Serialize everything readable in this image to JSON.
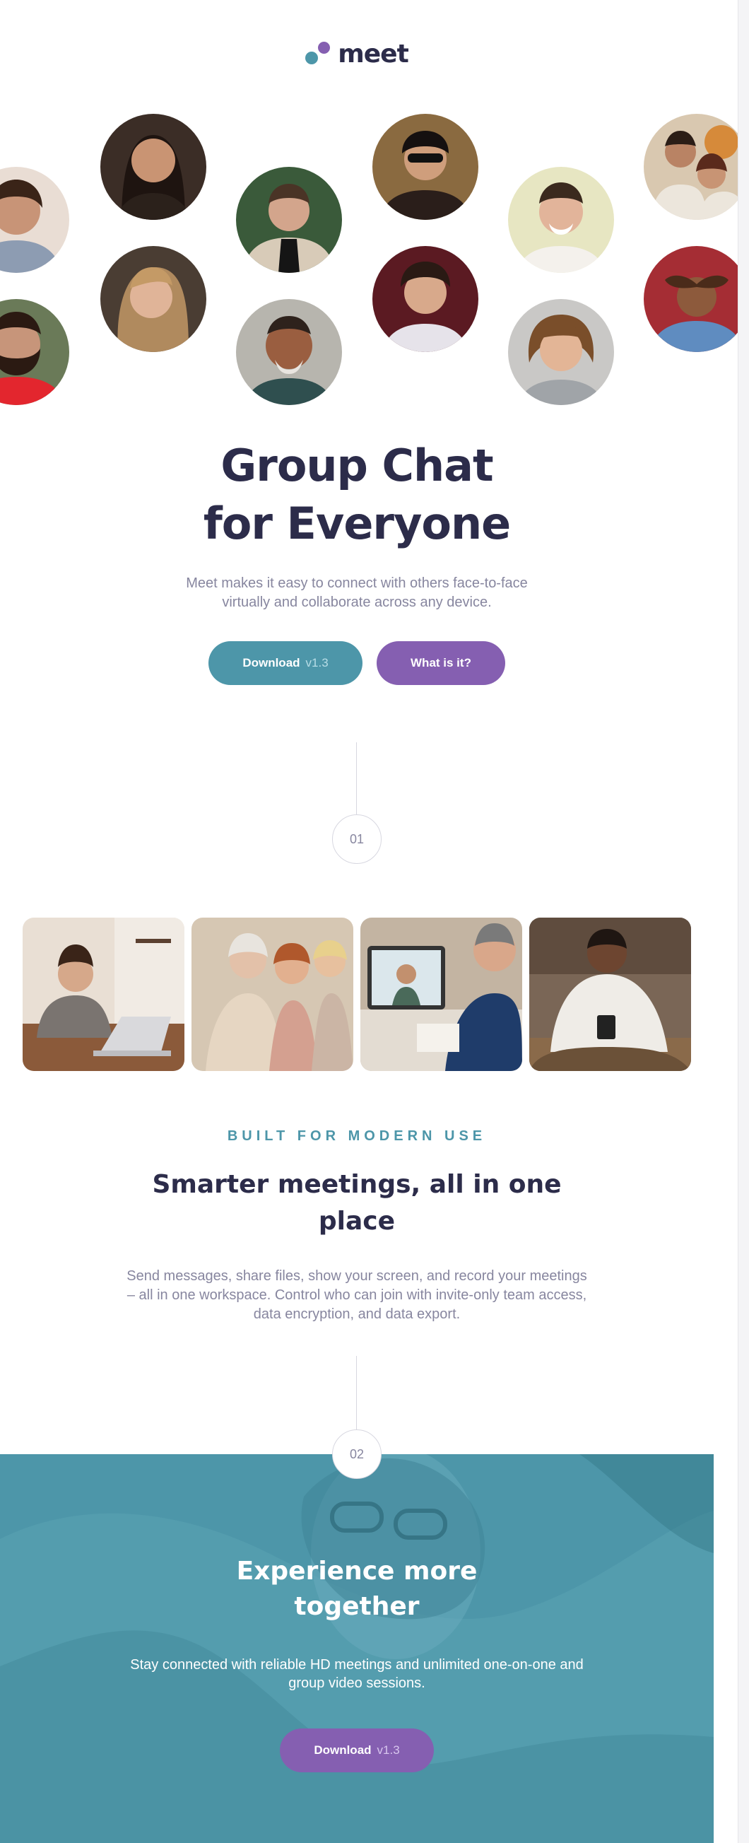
{
  "brand": {
    "name": "meet",
    "accent": "#4d96a9",
    "secondary": "#855fb1",
    "dark": "#2c2c4a"
  },
  "avatars": [
    "person-portrait-1",
    "person-portrait-2",
    "person-portrait-3",
    "person-portrait-4",
    "person-portrait-5",
    "person-portrait-6",
    "person-portrait-7",
    "person-portrait-8",
    "person-portrait-9",
    "person-portrait-10",
    "person-portrait-11",
    "person-portrait-12"
  ],
  "hero": {
    "title_line1": "Group Chat",
    "title_line2": "for Everyone",
    "subtitle": "Meet makes it easy to connect with others face-to-face virtually and collaborate across any device.",
    "download_label": "Download",
    "download_version": "v1.3",
    "what_label": "What is it?"
  },
  "step1": {
    "number": "01"
  },
  "photos": [
    "woman-laptop-photo",
    "women-phone-photo",
    "man-video-call-photo",
    "man-phone-photo"
  ],
  "section1": {
    "eyebrow": "BUILT FOR MODERN USE",
    "title_line1": "Smarter meetings, all in one",
    "title_line2": "place",
    "body": "Send messages, share files, show your screen, and record your meetings – all in one workspace. Control who can join with invite-only team access, data encryption, and data export."
  },
  "step2": {
    "number": "02"
  },
  "section2": {
    "title_line1": "Experience more",
    "title_line2": "together",
    "body": "Stay connected with reliable HD meetings and unlimited one-on-one and group video sessions.",
    "download_label": "Download",
    "download_version": "v1.3"
  }
}
